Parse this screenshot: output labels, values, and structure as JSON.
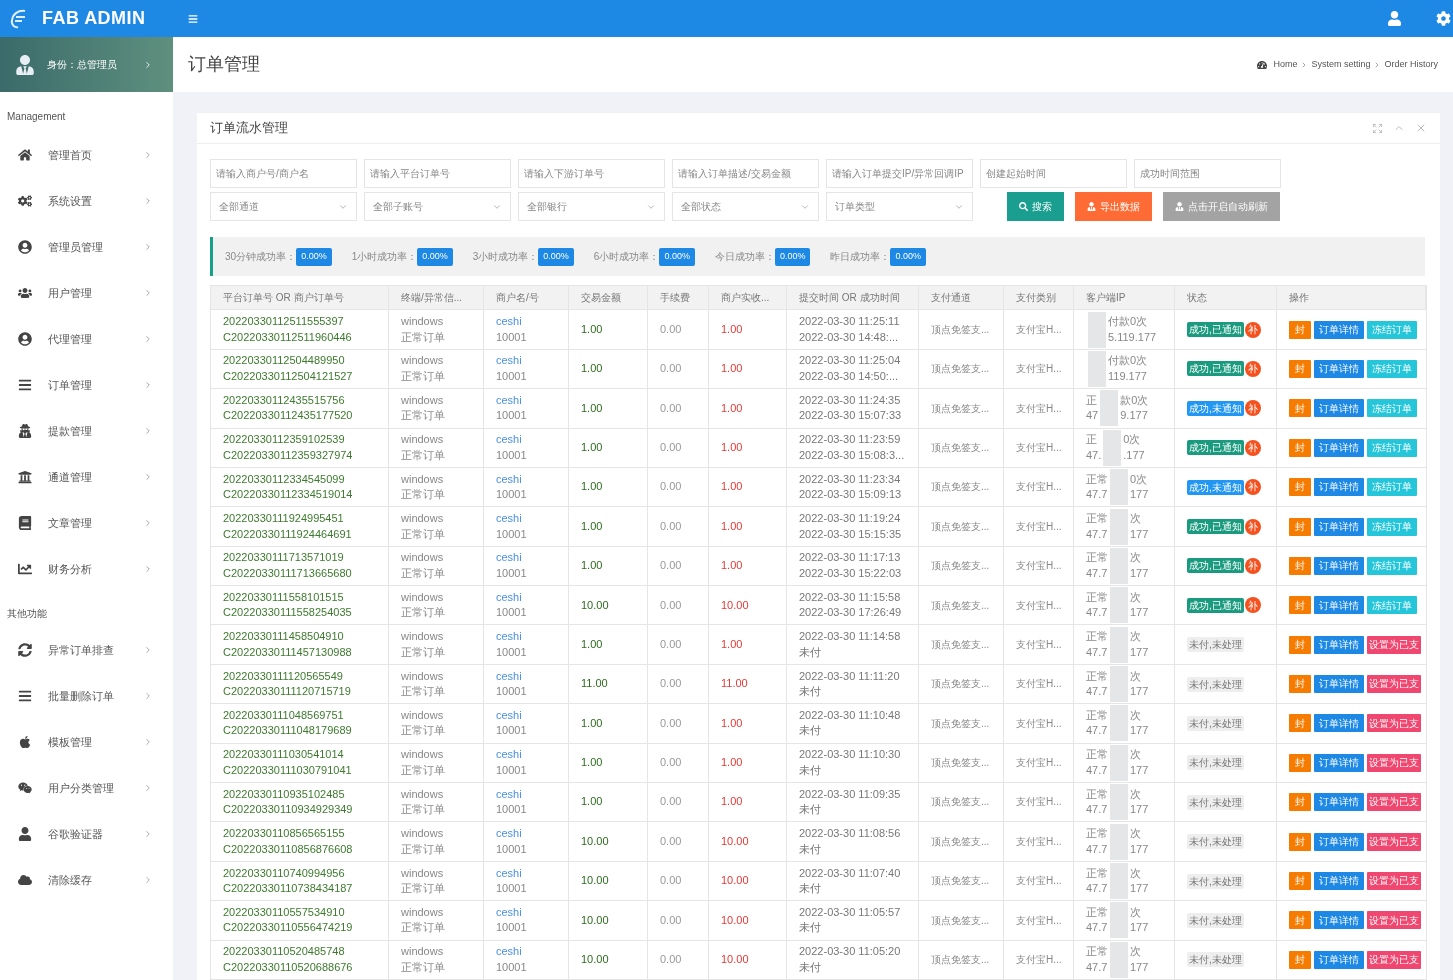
{
  "header": {
    "logo": "FAB ADMIN"
  },
  "sidebar": {
    "profile": "身份：总管理员",
    "sections": [
      {
        "title": "Management",
        "items": [
          "管理首页",
          "系统设置",
          "管理员管理",
          "用户管理",
          "代理管理",
          "订单管理",
          "提款管理",
          "通道管理",
          "文章管理",
          "财务分析"
        ]
      },
      {
        "title": "其他功能",
        "items": [
          "异常订单排查",
          "批量删除订单",
          "模板管理",
          "用户分类管理",
          "谷歌验证器",
          "清除缓存"
        ]
      }
    ]
  },
  "page_title": "订单管理",
  "breadcrumb": [
    "Home",
    "System setting",
    "Order History"
  ],
  "card": {
    "title": "订单流水管理",
    "inputs": [
      {
        "placeholder": "请输入商户号/商户名"
      },
      {
        "placeholder": "请输入平台订单号"
      },
      {
        "placeholder": "请输入下游订单号"
      },
      {
        "placeholder": "请输入订单描述/交易金额"
      },
      {
        "placeholder": "请输入订单提交IP/异常回调IP"
      },
      {
        "placeholder": "创建起始时间"
      },
      {
        "placeholder": "成功时间范围"
      }
    ],
    "selects": [
      "全部通道",
      "全部子账号",
      "全部银行",
      "全部状态",
      "订单类型"
    ],
    "buttons": [
      {
        "label": "搜索",
        "kind": "search"
      },
      {
        "label": "导出数据",
        "kind": "export"
      },
      {
        "label": "点击开启自动刷新",
        "kind": "refresh"
      }
    ],
    "rates": [
      {
        "label": "30分钟成功率：",
        "value": "0.00%"
      },
      {
        "label": "1小时成功率：",
        "value": "0.00%"
      },
      {
        "label": "3小时成功率：",
        "value": "0.00%"
      },
      {
        "label": "6小时成功率：",
        "value": "0.00%"
      },
      {
        "label": "今日成功率：",
        "value": "0.00%"
      },
      {
        "label": "昨日成功率：",
        "value": "0.00%"
      }
    ],
    "columns": [
      "平台订单号 OR 商户订单号",
      "终端/异常信...",
      "商户名/号",
      "交易金额",
      "手续费",
      "商户实收...",
      "提交时间 OR 成功时间",
      "支付通道",
      "支付类别",
      "客户端IP",
      "状态",
      "操作"
    ],
    "rows": [
      {
        "order": "20220330112511555397",
        "merchant_order": "C20220330112511960446",
        "terminal": "windows",
        "order_type": "正常订单",
        "merchant_name": "ceshi",
        "merchant_id": "10001",
        "amount": "1.00",
        "fee": "0.00",
        "income": "1.00",
        "submit": "2022-03-30 11:25:11",
        "success": "2022-03-30 14:48:...",
        "channel": "顶点免签支...",
        "pay_type": "支付宝H...",
        "ip": {
          "tail1": "付款0次",
          "tail2": "5.119.177"
        },
        "status": {
          "text": "成功,已通知",
          "kind": "notified",
          "supplement": "补"
        },
        "actions": [
          {
            "label": "封",
            "kind": "ban"
          },
          {
            "label": "订单详情",
            "kind": "detail"
          },
          {
            "label": "冻结订单",
            "kind": "freeze"
          }
        ]
      },
      {
        "order": "20220330112504489950",
        "merchant_order": "C20220330112504121527",
        "terminal": "windows",
        "order_type": "正常订单",
        "merchant_name": "ceshi",
        "merchant_id": "10001",
        "amount": "1.00",
        "fee": "0.00",
        "income": "1.00",
        "submit": "2022-03-30 11:25:04",
        "success": "2022-03-30 14:50:...",
        "channel": "顶点免签支...",
        "pay_type": "支付宝H...",
        "ip": {
          "tail1": "付款0次",
          "tail2": "119.177"
        },
        "status": {
          "text": "成功,已通知",
          "kind": "notified",
          "supplement": "补"
        },
        "actions": [
          {
            "label": "封",
            "kind": "ban"
          },
          {
            "label": "订单详情",
            "kind": "detail"
          },
          {
            "label": "冻结订单",
            "kind": "freeze"
          }
        ]
      },
      {
        "order": "20220330112435515756",
        "merchant_order": "C20220330112435177520",
        "terminal": "windows",
        "order_type": "正常订单",
        "merchant_name": "ceshi",
        "merchant_id": "10001",
        "amount": "1.00",
        "fee": "0.00",
        "income": "1.00",
        "submit": "2022-03-30 11:24:35",
        "success": "2022-03-30 15:07:33",
        "channel": "顶点免签支...",
        "pay_type": "支付宝H...",
        "ip": {
          "head1": "正",
          "tail1": "款0次",
          "head2": "47",
          "tail2": "9.177"
        },
        "status": {
          "text": "成功,未通知",
          "kind": "unnotified",
          "supplement": "补"
        },
        "actions": [
          {
            "label": "封",
            "kind": "ban"
          },
          {
            "label": "订单详情",
            "kind": "detail"
          },
          {
            "label": "冻结订单",
            "kind": "freeze"
          }
        ]
      },
      {
        "order": "20220330112359102539",
        "merchant_order": "C20220330112359327974",
        "terminal": "windows",
        "order_type": "正常订单",
        "merchant_name": "ceshi",
        "merchant_id": "10001",
        "amount": "1.00",
        "fee": "0.00",
        "income": "1.00",
        "submit": "2022-03-30 11:23:59",
        "success": "2022-03-30 15:08:3...",
        "channel": "顶点免签支...",
        "pay_type": "支付宝H...",
        "ip": {
          "head1": "正",
          "tail1": "0次",
          "head2": "47.",
          "tail2": ".177"
        },
        "status": {
          "text": "成功,已通知",
          "kind": "notified",
          "supplement": "补"
        },
        "actions": [
          {
            "label": "封",
            "kind": "ban"
          },
          {
            "label": "订单详情",
            "kind": "detail"
          },
          {
            "label": "冻结订单",
            "kind": "freeze"
          }
        ]
      },
      {
        "order": "20220330112334545099",
        "merchant_order": "C20220330112334519014",
        "terminal": "windows",
        "order_type": "正常订单",
        "merchant_name": "ceshi",
        "merchant_id": "10001",
        "amount": "1.00",
        "fee": "0.00",
        "income": "1.00",
        "submit": "2022-03-30 11:23:34",
        "success": "2022-03-30 15:09:13",
        "channel": "顶点免签支...",
        "pay_type": "支付宝H...",
        "ip": {
          "head1": "正常",
          "tail1": "0次",
          "head2": "47.7",
          "tail2": "177"
        },
        "status": {
          "text": "成功,未通知",
          "kind": "unnotified",
          "supplement": "补"
        },
        "actions": [
          {
            "label": "封",
            "kind": "ban"
          },
          {
            "label": "订单详情",
            "kind": "detail"
          },
          {
            "label": "冻结订单",
            "kind": "freeze"
          }
        ]
      },
      {
        "order": "20220330111924995451",
        "merchant_order": "C20220330111924464691",
        "terminal": "windows",
        "order_type": "正常订单",
        "merchant_name": "ceshi",
        "merchant_id": "10001",
        "amount": "1.00",
        "fee": "0.00",
        "income": "1.00",
        "submit": "2022-03-30 11:19:24",
        "success": "2022-03-30 15:15:35",
        "channel": "顶点免签支...",
        "pay_type": "支付宝H...",
        "ip": {
          "head1": "正常",
          "tail1": "次",
          "head2": "47.7",
          "tail2": "177"
        },
        "status": {
          "text": "成功,已通知",
          "kind": "notified",
          "supplement": "补"
        },
        "actions": [
          {
            "label": "封",
            "kind": "ban"
          },
          {
            "label": "订单详情",
            "kind": "detail"
          },
          {
            "label": "冻结订单",
            "kind": "freeze"
          }
        ]
      },
      {
        "order": "20220330111713571019",
        "merchant_order": "C20220330111713665680",
        "terminal": "windows",
        "order_type": "正常订单",
        "merchant_name": "ceshi",
        "merchant_id": "10001",
        "amount": "1.00",
        "fee": "0.00",
        "income": "1.00",
        "submit": "2022-03-30 11:17:13",
        "success": "2022-03-30 15:22:03",
        "channel": "顶点免签支...",
        "pay_type": "支付宝H...",
        "ip": {
          "head1": "正常",
          "tail1": "次",
          "head2": "47.7",
          "tail2": "177"
        },
        "status": {
          "text": "成功,已通知",
          "kind": "notified",
          "supplement": "补"
        },
        "actions": [
          {
            "label": "封",
            "kind": "ban"
          },
          {
            "label": "订单详情",
            "kind": "detail"
          },
          {
            "label": "冻结订单",
            "kind": "freeze"
          }
        ]
      },
      {
        "order": "20220330111558101515",
        "merchant_order": "C20220330111558254035",
        "terminal": "windows",
        "order_type": "正常订单",
        "merchant_name": "ceshi",
        "merchant_id": "10001",
        "amount": "10.00",
        "fee": "0.00",
        "income": "10.00",
        "submit": "2022-03-30 11:15:58",
        "success": "2022-03-30 17:26:49",
        "channel": "顶点免签支...",
        "pay_type": "支付宝H...",
        "ip": {
          "head1": "正常",
          "tail1": "次",
          "head2": "47.7",
          "tail2": "177"
        },
        "status": {
          "text": "成功,已通知",
          "kind": "notified",
          "supplement": "补"
        },
        "actions": [
          {
            "label": "封",
            "kind": "ban"
          },
          {
            "label": "订单详情",
            "kind": "detail"
          },
          {
            "label": "冻结订单",
            "kind": "freeze"
          }
        ]
      },
      {
        "order": "20220330111458504910",
        "merchant_order": "C20220330111457130988",
        "terminal": "windows",
        "order_type": "正常订单",
        "merchant_name": "ceshi",
        "merchant_id": "10001",
        "amount": "1.00",
        "fee": "0.00",
        "income": "1.00",
        "submit": "2022-03-30 11:14:58",
        "success": "未付",
        "channel": "顶点免签支...",
        "pay_type": "支付宝H...",
        "ip": {
          "head1": "正常",
          "tail1": "次",
          "head2": "47.7",
          "tail2": "177"
        },
        "status": {
          "text": "未付,未处理",
          "kind": "unpaid"
        },
        "actions": [
          {
            "label": "封",
            "kind": "ban"
          },
          {
            "label": "订单详情",
            "kind": "detail"
          },
          {
            "label": "设置为已支",
            "kind": "setpaid"
          }
        ]
      },
      {
        "order": "20220330111120565549",
        "merchant_order": "C20220330111120715719",
        "terminal": "windows",
        "order_type": "正常订单",
        "merchant_name": "ceshi",
        "merchant_id": "10001",
        "amount": "11.00",
        "fee": "0.00",
        "income": "11.00",
        "submit": "2022-03-30 11:11:20",
        "success": "未付",
        "channel": "顶点免签支...",
        "pay_type": "支付宝H...",
        "ip": {
          "head1": "正常",
          "tail1": "次",
          "head2": "47.7",
          "tail2": "177"
        },
        "status": {
          "text": "未付,未处理",
          "kind": "unpaid"
        },
        "actions": [
          {
            "label": "封",
            "kind": "ban"
          },
          {
            "label": "订单详情",
            "kind": "detail"
          },
          {
            "label": "设置为已支",
            "kind": "setpaid"
          }
        ]
      },
      {
        "order": "20220330111048569751",
        "merchant_order": "C20220330111048179689",
        "terminal": "windows",
        "order_type": "正常订单",
        "merchant_name": "ceshi",
        "merchant_id": "10001",
        "amount": "1.00",
        "fee": "0.00",
        "income": "1.00",
        "submit": "2022-03-30 11:10:48",
        "success": "未付",
        "channel": "顶点免签支...",
        "pay_type": "支付宝H...",
        "ip": {
          "head1": "正常",
          "tail1": "次",
          "head2": "47.7",
          "tail2": "177"
        },
        "status": {
          "text": "未付,未处理",
          "kind": "unpaid"
        },
        "actions": [
          {
            "label": "封",
            "kind": "ban"
          },
          {
            "label": "订单详情",
            "kind": "detail"
          },
          {
            "label": "设置为已支",
            "kind": "setpaid"
          }
        ]
      },
      {
        "order": "20220330111030541014",
        "merchant_order": "C20220330111030791041",
        "terminal": "windows",
        "order_type": "正常订单",
        "merchant_name": "ceshi",
        "merchant_id": "10001",
        "amount": "1.00",
        "fee": "0.00",
        "income": "1.00",
        "submit": "2022-03-30 11:10:30",
        "success": "未付",
        "channel": "顶点免签支...",
        "pay_type": "支付宝H...",
        "ip": {
          "head1": "正常",
          "tail1": "次",
          "head2": "47.7",
          "tail2": "177"
        },
        "status": {
          "text": "未付,未处理",
          "kind": "unpaid"
        },
        "actions": [
          {
            "label": "封",
            "kind": "ban"
          },
          {
            "label": "订单详情",
            "kind": "detail"
          },
          {
            "label": "设置为已支",
            "kind": "setpaid"
          }
        ]
      },
      {
        "order": "20220330110935102485",
        "merchant_order": "C20220330110934929349",
        "terminal": "windows",
        "order_type": "正常订单",
        "merchant_name": "ceshi",
        "merchant_id": "10001",
        "amount": "1.00",
        "fee": "0.00",
        "income": "1.00",
        "submit": "2022-03-30 11:09:35",
        "success": "未付",
        "channel": "顶点免签支...",
        "pay_type": "支付宝H...",
        "ip": {
          "head1": "正常",
          "tail1": "次",
          "head2": "47.7",
          "tail2": "177"
        },
        "status": {
          "text": "未付,未处理",
          "kind": "unpaid"
        },
        "actions": [
          {
            "label": "封",
            "kind": "ban"
          },
          {
            "label": "订单详情",
            "kind": "detail"
          },
          {
            "label": "设置为已支",
            "kind": "setpaid"
          }
        ]
      },
      {
        "order": "20220330110856565155",
        "merchant_order": "C20220330110856876608",
        "terminal": "windows",
        "order_type": "正常订单",
        "merchant_name": "ceshi",
        "merchant_id": "10001",
        "amount": "10.00",
        "fee": "0.00",
        "income": "10.00",
        "submit": "2022-03-30 11:08:56",
        "success": "未付",
        "channel": "顶点免签支...",
        "pay_type": "支付宝H...",
        "ip": {
          "head1": "正常",
          "tail1": "次",
          "head2": "47.7",
          "tail2": "177"
        },
        "status": {
          "text": "未付,未处理",
          "kind": "unpaid"
        },
        "actions": [
          {
            "label": "封",
            "kind": "ban"
          },
          {
            "label": "订单详情",
            "kind": "detail"
          },
          {
            "label": "设置为已支",
            "kind": "setpaid"
          }
        ]
      },
      {
        "order": "20220330110740994956",
        "merchant_order": "C20220330110738434187",
        "terminal": "windows",
        "order_type": "正常订单",
        "merchant_name": "ceshi",
        "merchant_id": "10001",
        "amount": "10.00",
        "fee": "0.00",
        "income": "10.00",
        "submit": "2022-03-30 11:07:40",
        "success": "未付",
        "channel": "顶点免签支...",
        "pay_type": "支付宝H...",
        "ip": {
          "head1": "正常",
          "tail1": "次",
          "head2": "47.7",
          "tail2": "177"
        },
        "status": {
          "text": "未付,未处理",
          "kind": "unpaid"
        },
        "actions": [
          {
            "label": "封",
            "kind": "ban"
          },
          {
            "label": "订单详情",
            "kind": "detail"
          },
          {
            "label": "设置为已支",
            "kind": "setpaid"
          }
        ]
      },
      {
        "order": "20220330110557534910",
        "merchant_order": "C20220330110556474219",
        "terminal": "windows",
        "order_type": "正常订单",
        "merchant_name": "ceshi",
        "merchant_id": "10001",
        "amount": "10.00",
        "fee": "0.00",
        "income": "10.00",
        "submit": "2022-03-30 11:05:57",
        "success": "未付",
        "channel": "顶点免签支...",
        "pay_type": "支付宝H...",
        "ip": {
          "head1": "正常",
          "tail1": "次",
          "head2": "47.7",
          "tail2": "177"
        },
        "status": {
          "text": "未付,未处理",
          "kind": "unpaid"
        },
        "actions": [
          {
            "label": "封",
            "kind": "ban"
          },
          {
            "label": "订单详情",
            "kind": "detail"
          },
          {
            "label": "设置为已支",
            "kind": "setpaid"
          }
        ]
      },
      {
        "order": "20220330110520485748",
        "merchant_order": "C20220330110520688676",
        "terminal": "windows",
        "order_type": "正常订单",
        "merchant_name": "ceshi",
        "merchant_id": "10001",
        "amount": "10.00",
        "fee": "0.00",
        "income": "10.00",
        "submit": "2022-03-30 11:05:20",
        "success": "未付",
        "channel": "顶点免签支...",
        "pay_type": "支付宝H...",
        "ip": {
          "head1": "正常",
          "tail1": "次",
          "head2": "47.7",
          "tail2": "177"
        },
        "status": {
          "text": "未付,未处理",
          "kind": "unpaid"
        },
        "actions": [
          {
            "label": "封",
            "kind": "ban"
          },
          {
            "label": "订单详情",
            "kind": "detail"
          },
          {
            "label": "设置为已支",
            "kind": "setpaid"
          }
        ]
      }
    ]
  }
}
